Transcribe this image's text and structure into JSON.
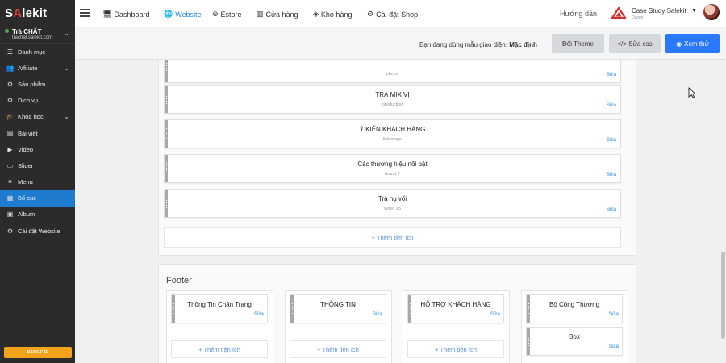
{
  "sidebar": {
    "logo": "SALEKIT",
    "store_name": "Trà CHẤT",
    "store_domain": "trachat.salekit.com",
    "items": [
      {
        "label": "Danh mục",
        "icon": "list-icon"
      },
      {
        "label": "Affiliate",
        "icon": "users-icon"
      },
      {
        "label": "Sản phẩm",
        "icon": "product-icon"
      },
      {
        "label": "Dịch vụ",
        "icon": "service-icon"
      },
      {
        "label": "Khóa học",
        "icon": "graduation-cap-icon"
      },
      {
        "label": "Bài viết",
        "icon": "article-icon"
      },
      {
        "label": "Video",
        "icon": "video-icon"
      },
      {
        "label": "Slider",
        "icon": "slider-icon"
      },
      {
        "label": "Menu",
        "icon": "menu-icon"
      },
      {
        "label": "Bố cục",
        "icon": "layout-icon"
      },
      {
        "label": "Album",
        "icon": "image-icon"
      },
      {
        "label": "Cài đặt Website",
        "icon": "settings-icon"
      }
    ],
    "active": "Bố cục",
    "upgrade_label": "NÂNG CẤP"
  },
  "topbar": {
    "menu": [
      {
        "label": "Dashboard",
        "icon": "monitor-icon"
      },
      {
        "label": "Website",
        "icon": "globe-icon"
      },
      {
        "label": "Estore",
        "icon": "compass-icon"
      },
      {
        "label": "Cửa hàng",
        "icon": "store-icon"
      },
      {
        "label": "Kho hàng",
        "icon": "stack-icon"
      },
      {
        "label": "Cài đặt Shop",
        "icon": "gear-icon"
      }
    ],
    "active_menu": "Website",
    "guide": "Hướng dẫn",
    "account_name": "Case Study Salekit",
    "account_role": "Owner"
  },
  "subbar": {
    "note_prefix": "Bạn đang dùng mẫu giao diện:",
    "theme_name": "Mặc định",
    "change_theme": "Đổi Theme",
    "edit_css": "</> Sửa css",
    "preview": "Xem thử"
  },
  "layout": {
    "widgets": [
      {
        "title": "",
        "type": "phone",
        "edit": "Sửa"
      },
      {
        "title": "TRÀ MIX VỊ",
        "type": "productlist",
        "edit": "Sửa"
      },
      {
        "title": "Ý KIẾN KHÁCH HÀNG",
        "type": "linkimage",
        "edit": "Sửa"
      },
      {
        "title": "Các thương hiệu nổi bật",
        "type": "brand 7",
        "edit": "Sửa"
      },
      {
        "title": "Trà nụ vối",
        "type": "video 15",
        "edit": "Sửa"
      }
    ],
    "add_widget": "+ Thêm tiện ích"
  },
  "footer": {
    "title": "Footer",
    "columns": [
      {
        "widgets": [
          {
            "title": "Thông Tin Chân Trang",
            "edit": "Sửa"
          }
        ],
        "add": "+ Thêm tiện ích"
      },
      {
        "widgets": [
          {
            "title": "THÔNG TIN",
            "edit": "Sửa"
          }
        ],
        "add": "+ Thêm tiện ích"
      },
      {
        "widgets": [
          {
            "title": "HỖ TRỢ KHÁCH HÀNG",
            "edit": "Sửa"
          }
        ],
        "add": "+ Thêm tiện ích"
      },
      {
        "widgets": [
          {
            "title": "Bộ Công Thương",
            "edit": "Sửa"
          },
          {
            "title": "Box",
            "edit": "Sửa"
          }
        ]
      }
    ]
  }
}
